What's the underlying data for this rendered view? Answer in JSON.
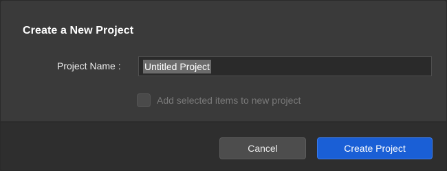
{
  "dialog": {
    "title": "Create a New Project"
  },
  "form": {
    "project_name_label": "Project Name :",
    "project_name_value": "Untitled Project",
    "checkbox_label": "Add selected items to new project",
    "checkbox_checked": false,
    "checkbox_enabled": false
  },
  "buttons": {
    "cancel_label": "Cancel",
    "create_label": "Create Project"
  },
  "colors": {
    "primary_button": "#1a5fd6",
    "dialog_bg": "#3a3a3a",
    "footer_bg": "#2e2e2e"
  }
}
